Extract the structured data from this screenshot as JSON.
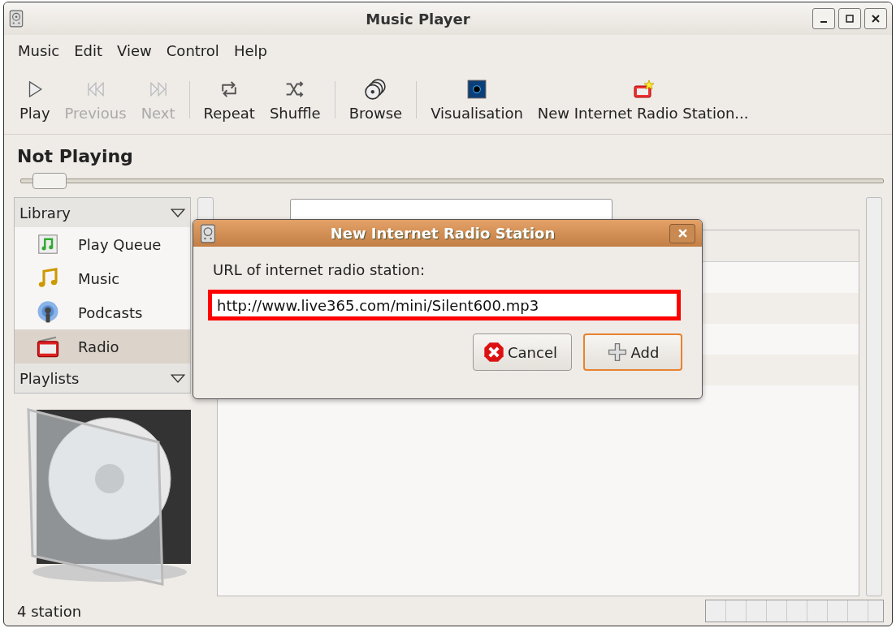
{
  "window": {
    "title": "Music Player"
  },
  "menu": [
    "Music",
    "Edit",
    "View",
    "Control",
    "Help"
  ],
  "toolbar": [
    {
      "kind": "play",
      "label": "Play",
      "disabled": false
    },
    {
      "kind": "previous",
      "label": "Previous",
      "disabled": true
    },
    {
      "kind": "next",
      "label": "Next",
      "disabled": true
    },
    {
      "kind": "repeat",
      "label": "Repeat",
      "disabled": false
    },
    {
      "kind": "shuffle",
      "label": "Shuffle",
      "disabled": false
    },
    {
      "kind": "browse",
      "label": "Browse",
      "disabled": false
    },
    {
      "kind": "visualisation",
      "label": "Visualisation",
      "disabled": false
    },
    {
      "kind": "radio",
      "label": "New Internet Radio Station...",
      "disabled": false
    }
  ],
  "now_playing": "Not Playing",
  "position_slider": {
    "level": 0.02
  },
  "sidebar": {
    "sections": [
      {
        "title": "Library",
        "items": [
          {
            "kind": "queue",
            "label": "Play Queue",
            "selected": false
          },
          {
            "kind": "music",
            "label": "Music",
            "selected": false
          },
          {
            "kind": "podcast",
            "label": "Podcasts",
            "selected": false
          },
          {
            "kind": "radio",
            "label": "Radio",
            "selected": true
          }
        ]
      },
      {
        "title": "Playlists"
      }
    ]
  },
  "dialog": {
    "title": "New Internet Radio Station",
    "prompt": "URL of internet radio station:",
    "url": "http://www.live365.com/mini/Silent600.mp3",
    "buttons": [
      {
        "kind": "cancel",
        "label": "Cancel"
      },
      {
        "kind": "add",
        "label": "Add"
      }
    ]
  },
  "status_bar": "4 station",
  "progress": {
    "level": 0
  }
}
